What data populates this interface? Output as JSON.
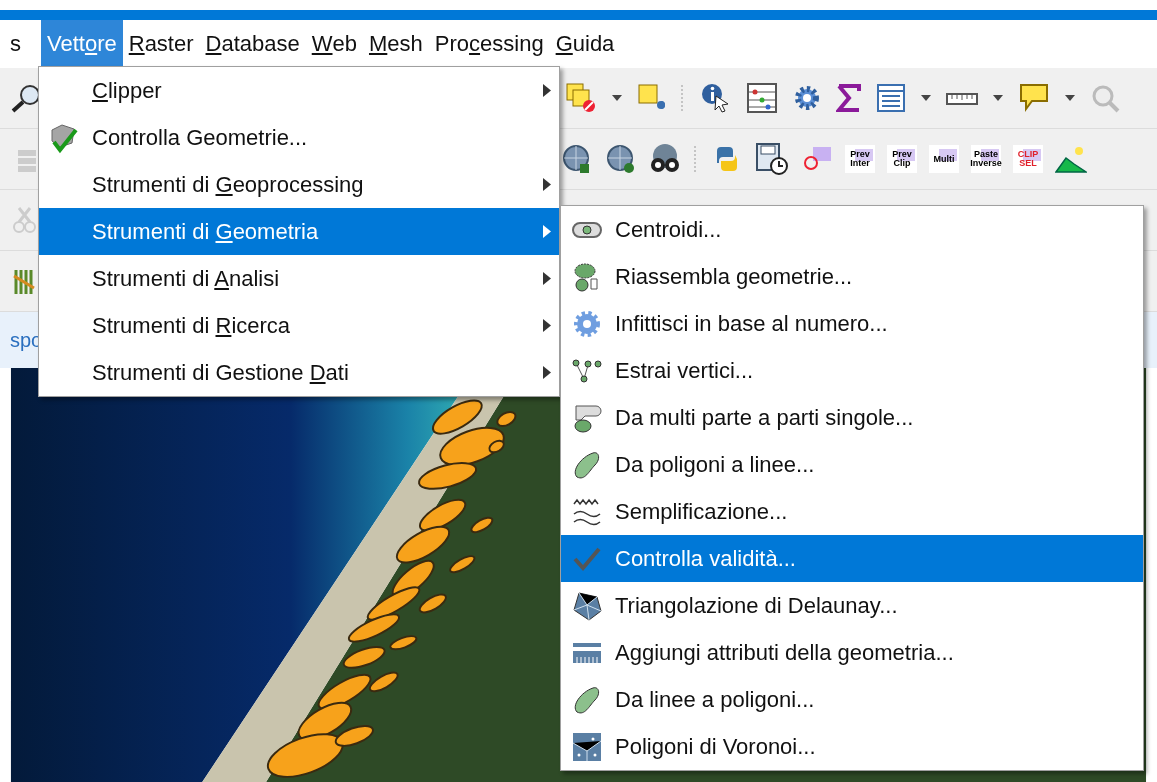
{
  "menubar": [
    {
      "text": "s",
      "selected": false
    },
    {
      "text": "Vett",
      "mnemonic": "o",
      "rest": "re",
      "selected": true
    },
    {
      "mnemonic": "R",
      "rest": "aster",
      "selected": false
    },
    {
      "mnemonic": "D",
      "rest": "atabase",
      "selected": false
    },
    {
      "mnemonic": "W",
      "rest": "eb",
      "selected": false
    },
    {
      "mnemonic": "M",
      "rest": "esh",
      "selected": false
    },
    {
      "text": "Pro",
      "mnemonic": "c",
      "rest": "essing",
      "selected": false
    },
    {
      "mnemonic": "G",
      "rest": "uida",
      "selected": false
    }
  ],
  "toolbar_text_buttons": [
    {
      "lines": [
        "Prev",
        "Inter"
      ],
      "color": "#000000"
    },
    {
      "lines": [
        "Prev",
        "Clip"
      ],
      "color": "#000000"
    },
    {
      "lines": [
        "Multi"
      ],
      "color": "#000000"
    },
    {
      "lines": [
        "Paste",
        "Inverse"
      ],
      "color": "#000000"
    },
    {
      "lines": [
        "CLIP",
        "SEL"
      ],
      "color": "#e0202a"
    }
  ],
  "info_bar": {
    "text": "spo"
  },
  "vector_menu": {
    "items": [
      {
        "mnemonic": "C",
        "rest": "lipper",
        "submenu": true,
        "selected": false
      },
      {
        "text": "Controlla Geometrie...",
        "submenu": false,
        "selected": false
      },
      {
        "text": "Strumenti di ",
        "mnemonic": "G",
        "rest": "eoprocessing",
        "submenu": true,
        "selected": false
      },
      {
        "text": "Strumenti di ",
        "mnemonic": "G",
        "rest": "eometria",
        "submenu": true,
        "selected": true
      },
      {
        "text": "Strumenti di ",
        "mnemonic": "A",
        "rest": "nalisi",
        "submenu": true,
        "selected": false
      },
      {
        "text": "Strumenti di ",
        "mnemonic": "R",
        "rest": "icerca",
        "submenu": true,
        "selected": false
      },
      {
        "text": "Strumenti di Gestione ",
        "mnemonic": "D",
        "rest": "ati",
        "submenu": true,
        "selected": false
      }
    ]
  },
  "geometry_submenu": {
    "items": [
      {
        "text": "Centroidi...",
        "selected": false
      },
      {
        "text": "Riassembla geometrie...",
        "selected": false
      },
      {
        "text": "Infittisci in base al numero...",
        "selected": false
      },
      {
        "text": "Estrai vertici...",
        "selected": false
      },
      {
        "text": "Da multi parte a parti singole...",
        "selected": false
      },
      {
        "text": "Da poligoni a linee...",
        "selected": false
      },
      {
        "text": "Semplificazione...",
        "selected": false
      },
      {
        "text": "Controlla validità...",
        "selected": true
      },
      {
        "text": "Triangolazione di Delaunay...",
        "selected": false
      },
      {
        "text": "Aggiungi attributi della geometria...",
        "selected": false
      },
      {
        "text": "Da linee a poligoni...",
        "selected": false
      },
      {
        "text": "Poligoni di Voronoi...",
        "selected": false
      }
    ]
  }
}
